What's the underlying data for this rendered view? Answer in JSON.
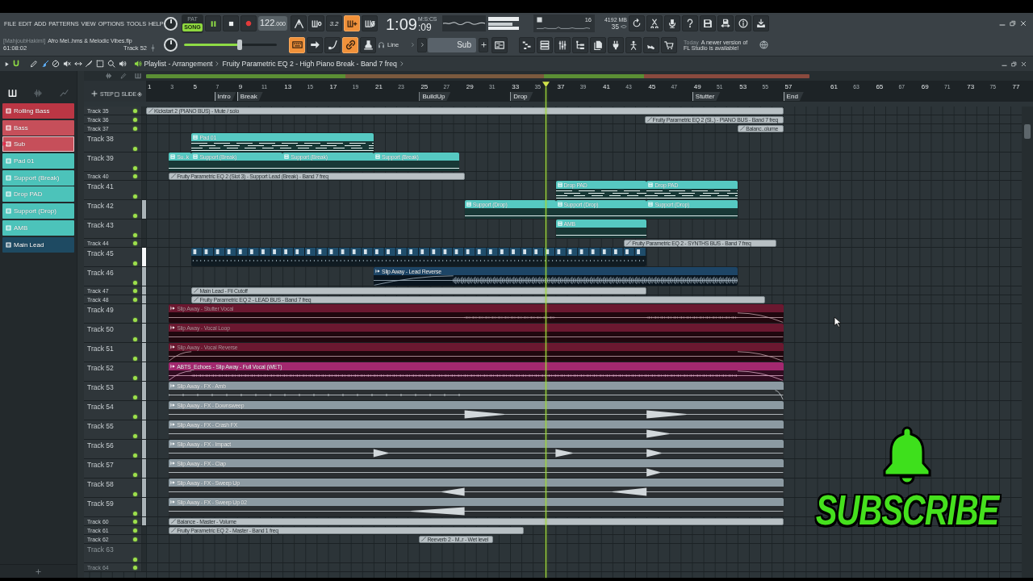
{
  "menu": [
    "FILE",
    "EDIT",
    "ADD",
    "PATTERNS",
    "VIEW",
    "OPTIONS",
    "TOOLS",
    "HELP"
  ],
  "project": {
    "author": "[MahjoubHakimi]",
    "file": "Afro Mel..hms & Melodic Vibes.flp",
    "position": "61:08:02",
    "track": "Track 52"
  },
  "transport": {
    "modes": [
      {
        "label": "PAT",
        "selected": false
      },
      {
        "label": "SONG",
        "selected": true
      }
    ],
    "playing": true,
    "tempo": "122",
    "tempo_fraction": ".000",
    "time": "1:09",
    "centiseconds": ":09",
    "time_format": "M:S:CS"
  },
  "tools": [
    {
      "on": false
    },
    {
      "on": false
    },
    {
      "label": "3.2",
      "on": false
    },
    {
      "on": true
    },
    {
      "on": false
    }
  ],
  "performance": {
    "cpu": "16",
    "memory": "4192 MB",
    "polyphony": "35"
  },
  "master_volume": {
    "level": 0.6
  },
  "edit_tools": [
    {
      "on": true
    },
    {
      "on": false
    },
    {
      "on": false
    },
    {
      "on": true
    },
    {
      "on": false
    }
  ],
  "snap": {
    "value": "Line"
  },
  "pattern_selector": {
    "value": "Sub"
  },
  "news": {
    "date": "Today",
    "lines": [
      "A newer version of",
      "FL Studio is available!"
    ]
  },
  "playlist": {
    "title": "Playlist - Arrangement",
    "path": "Fruity Parametric EQ 2 - High Piano Break - Band 7 freq",
    "snap_on": true,
    "tools": [
      {
        "selected": false
      },
      {
        "selected": true
      },
      {
        "selected": false
      },
      {
        "selected": false
      },
      {
        "selected": false
      },
      {
        "selected": false
      },
      {
        "selected": false
      },
      {
        "selected": false
      },
      {
        "selected": false
      }
    ]
  },
  "picker": {
    "tabs": [
      {
        "selected": true
      },
      {
        "selected": false
      },
      {
        "selected": false
      }
    ],
    "patterns": [
      {
        "name": "Rolling Bass",
        "color": "#bb3644",
        "selected": false
      },
      {
        "name": "Bass",
        "color": "#c64f5a",
        "selected": false
      },
      {
        "name": "Sub",
        "color": "#c64f5a",
        "selected": true
      },
      {
        "name": "Pad 01",
        "color": "#4cc3ba",
        "selected": false
      },
      {
        "name": "Support (Break)",
        "color": "#4cc3ba",
        "selected": false
      },
      {
        "name": "Drop PAD",
        "color": "#4cc3ba",
        "selected": false
      },
      {
        "name": "Support (Drop)",
        "color": "#4cc3ba",
        "selected": false
      },
      {
        "name": "AMB",
        "color": "#4cc3ba",
        "selected": false
      },
      {
        "name": "Main Lead",
        "color": "#1e4a62",
        "selected": false
      }
    ]
  },
  "track_options": [
    {
      "label": "STEP",
      "on": false
    },
    {
      "label": "SLIDE",
      "on": false
    }
  ],
  "ruler": {
    "bars": [
      "1",
      "3",
      "5",
      "7",
      "9",
      "11",
      "13",
      "15",
      "17",
      "19",
      "21",
      "23",
      "25",
      "27",
      "29",
      "31",
      "33",
      "35",
      "37",
      "39",
      "41",
      "43",
      "45",
      "47",
      "49",
      "51",
      "53",
      "55",
      "57",
      "61",
      "63",
      "65",
      "67",
      "69",
      "71",
      "73",
      "75",
      "77"
    ],
    "markers": [
      "Intro",
      "Break",
      "BuildUp",
      "Drop",
      "Stutter",
      "End"
    ]
  },
  "tracks": [
    {
      "name": "Track 35",
      "compact": true,
      "on": true,
      "in_use": true,
      "marked": false,
      "selected": false,
      "clips": [
        {
          "kind": "automation",
          "name": "Kickstart 2 (PIANO BUS) - Mute / solo",
          "color": "#b8c0c4"
        }
      ]
    },
    {
      "name": "Track 36",
      "compact": true,
      "on": true,
      "in_use": true,
      "marked": false,
      "selected": false,
      "clips": [
        {
          "kind": "automation",
          "name": "Fruity Parametric EQ 2 (Sl..) - PIANO BUS - Band 7 freq",
          "color": "#b8c0c4"
        }
      ]
    },
    {
      "name": "Track 37",
      "compact": true,
      "on": true,
      "in_use": true,
      "marked": false,
      "selected": false,
      "clips": [
        {
          "kind": "automation",
          "name": "Balanc..olume",
          "color": "#b8c0c4"
        }
      ]
    },
    {
      "name": "Track 38",
      "compact": false,
      "on": true,
      "in_use": true,
      "marked": false,
      "selected": false,
      "clips": [
        {
          "kind": "pattern",
          "name": "Pad 01",
          "color": "#56c9c2"
        }
      ]
    },
    {
      "name": "Track 39",
      "compact": false,
      "on": true,
      "in_use": true,
      "marked": false,
      "selected": false,
      "clips": [
        {
          "kind": "pattern",
          "name": "Su..k",
          "color": "#56c9c2"
        },
        {
          "kind": "pattern",
          "name": "Support (Break)",
          "color": "#56c9c2"
        },
        {
          "kind": "pattern",
          "name": "Support (Break)",
          "color": "#56c9c2"
        },
        {
          "kind": "pattern",
          "name": "Support (Break)",
          "color": "#56c9c2"
        }
      ]
    },
    {
      "name": "Track 40",
      "compact": true,
      "on": true,
      "in_use": true,
      "marked": false,
      "selected": false,
      "clips": [
        {
          "kind": "automation",
          "name": "Fruity Parametric EQ 2 (Slot 3) - Support Lead (Break) - Band 7 freq",
          "color": "#b8c0c4"
        }
      ]
    },
    {
      "name": "Track 41",
      "compact": false,
      "on": true,
      "in_use": true,
      "marked": false,
      "selected": false,
      "clips": [
        {
          "kind": "pattern",
          "name": "Drop PAD",
          "color": "#56c9c2"
        },
        {
          "kind": "pattern",
          "name": "Drop PAD",
          "color": "#56c9c2"
        }
      ]
    },
    {
      "name": "Track 42",
      "compact": false,
      "on": true,
      "in_use": true,
      "marked": true,
      "selected": false,
      "clips": [
        {
          "kind": "pattern",
          "name": "Support (Drop)",
          "color": "#56c9c2"
        },
        {
          "kind": "pattern",
          "name": "Support (Drop)",
          "color": "#56c9c2"
        },
        {
          "kind": "pattern",
          "name": "Support (Drop)",
          "color": "#56c9c2"
        }
      ]
    },
    {
      "name": "Track 43",
      "compact": false,
      "on": true,
      "in_use": true,
      "marked": false,
      "selected": false,
      "clips": [
        {
          "kind": "pattern",
          "name": "AMB",
          "color": "#56c9c2"
        }
      ]
    },
    {
      "name": "Track 44",
      "compact": true,
      "on": true,
      "in_use": true,
      "marked": false,
      "selected": false,
      "clips": [
        {
          "kind": "automation",
          "name": "Fruity Parametric EQ 2 - SYNTHS BUS - Band 7 freq",
          "color": "#b8c0c4"
        }
      ]
    },
    {
      "name": "Track 45",
      "compact": false,
      "on": true,
      "in_use": true,
      "marked": false,
      "selected": true,
      "clips": [
        {
          "kind": "pattern_run",
          "color": "#1f4d6b"
        }
      ]
    },
    {
      "name": "Track 46",
      "compact": false,
      "on": true,
      "in_use": true,
      "marked": true,
      "selected": false,
      "clips": [
        {
          "kind": "audio",
          "name": "Slip Away - Lead Reverse",
          "color": "#1d4566"
        }
      ]
    },
    {
      "name": "Track 47",
      "compact": true,
      "on": true,
      "in_use": true,
      "marked": true,
      "selected": false,
      "clips": [
        {
          "kind": "automation",
          "name": "Main Lead - Fil Cutoff",
          "color": "#b8c0c4"
        }
      ]
    },
    {
      "name": "Track 48",
      "compact": true,
      "on": true,
      "in_use": true,
      "marked": true,
      "selected": false,
      "clips": [
        {
          "kind": "automation",
          "name": "Fruity Parametric EQ 2 - LEAD BUS - Band 7 freq",
          "color": "#b8c0c4"
        }
      ]
    },
    {
      "name": "Track 49",
      "compact": false,
      "on": true,
      "in_use": true,
      "marked": true,
      "selected": false,
      "clips": [
        {
          "kind": "audio",
          "name": "Slip Away - Stutter Vocal",
          "color": "#6b1830"
        }
      ]
    },
    {
      "name": "Track 50",
      "compact": false,
      "on": true,
      "in_use": true,
      "marked": true,
      "selected": false,
      "clips": [
        {
          "kind": "audio",
          "name": "Slip Away - Vocal Loop",
          "color": "#6b1830"
        }
      ]
    },
    {
      "name": "Track 51",
      "compact": false,
      "on": true,
      "in_use": true,
      "marked": true,
      "selected": false,
      "clips": [
        {
          "kind": "audio",
          "name": "Slip Away - Vocal Reverse",
          "color": "#6b1830"
        }
      ]
    },
    {
      "name": "Track 52",
      "compact": false,
      "on": true,
      "in_use": true,
      "marked": true,
      "selected": false,
      "clips": [
        {
          "kind": "audio",
          "name": "ABTS_Echoes - Slip Away - Full Vocal (WET)",
          "color": "#a3286f"
        }
      ]
    },
    {
      "name": "Track 53",
      "compact": false,
      "on": true,
      "in_use": true,
      "marked": true,
      "selected": false,
      "clips": [
        {
          "kind": "audio",
          "name": "Slip Away - FX - Amb",
          "color": "#8c9aa2"
        }
      ]
    },
    {
      "name": "Track 54",
      "compact": false,
      "on": true,
      "in_use": true,
      "marked": true,
      "selected": false,
      "clips": [
        {
          "kind": "audio",
          "name": "Slip Away - FX - Downsweep",
          "color": "#8c9aa2"
        }
      ]
    },
    {
      "name": "Track 55",
      "compact": false,
      "on": true,
      "in_use": true,
      "marked": true,
      "selected": false,
      "clips": [
        {
          "kind": "audio",
          "name": "Slip Away - FX - Crash FX",
          "color": "#8c9aa2"
        }
      ]
    },
    {
      "name": "Track 56",
      "compact": false,
      "on": true,
      "in_use": true,
      "marked": true,
      "selected": false,
      "clips": [
        {
          "kind": "audio",
          "name": "Slip Away - FX - Impact",
          "color": "#8c9aa2"
        }
      ]
    },
    {
      "name": "Track 57",
      "compact": false,
      "on": true,
      "in_use": true,
      "marked": true,
      "selected": false,
      "clips": [
        {
          "kind": "audio",
          "name": "Slip Away - FX - Clap",
          "color": "#8c9aa2"
        }
      ]
    },
    {
      "name": "Track 58",
      "compact": false,
      "on": true,
      "in_use": true,
      "marked": true,
      "selected": false,
      "clips": [
        {
          "kind": "audio",
          "name": "Slip Away - FX - Sweep Up",
          "color": "#8c9aa2"
        }
      ]
    },
    {
      "name": "Track 59",
      "compact": false,
      "on": true,
      "in_use": true,
      "marked": true,
      "selected": false,
      "clips": [
        {
          "kind": "audio",
          "name": "Slip Away - FX - Sweep Up 02",
          "color": "#8c9aa2"
        }
      ]
    },
    {
      "name": "Track 60",
      "compact": true,
      "on": true,
      "in_use": true,
      "marked": true,
      "selected": false,
      "clips": [
        {
          "kind": "automation",
          "name": "Balance - Master - Volume",
          "color": "#b8c0c4"
        }
      ]
    },
    {
      "name": "Track 61",
      "compact": true,
      "on": true,
      "in_use": true,
      "marked": false,
      "selected": false,
      "clips": [
        {
          "kind": "automation",
          "name": "Fruity Parametric EQ 2 - Master - Band 1 freq",
          "color": "#b8c0c4"
        }
      ]
    },
    {
      "name": "Track 62",
      "compact": true,
      "on": true,
      "in_use": true,
      "marked": false,
      "selected": false,
      "clips": [
        {
          "kind": "automation",
          "name": "Reeverb 2 - M..r - Wet level",
          "color": "#b8c0c4"
        }
      ]
    },
    {
      "name": "Track 63",
      "compact": false,
      "on": true,
      "in_use": false,
      "marked": false,
      "selected": false
    },
    {
      "name": "Track 64",
      "compact": true,
      "on": true,
      "in_use": false,
      "marked": false,
      "selected": false
    }
  ],
  "overlay": {
    "text": "SUBSCRIBE"
  }
}
